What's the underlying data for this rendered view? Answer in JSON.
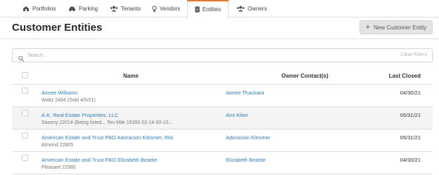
{
  "nav": {
    "tabs": [
      {
        "label": "Portfolios",
        "icon": "building-icon",
        "active": false
      },
      {
        "label": "Parking",
        "icon": "car-icon",
        "active": false
      },
      {
        "label": "Tenants",
        "icon": "users-icon",
        "active": false
      },
      {
        "label": "Vendors",
        "icon": "lightbulb-icon",
        "active": false
      },
      {
        "label": "Entities",
        "icon": "document-icon",
        "active": true
      },
      {
        "label": "Owners",
        "icon": "users-icon",
        "active": false
      }
    ]
  },
  "page": {
    "title": "Customer Entities",
    "new_button_label": "New Customer Entity"
  },
  "search": {
    "placeholder": "Search...",
    "value": "",
    "clear_label": "Clear Filters"
  },
  "table": {
    "columns": [
      "Name",
      "Owner Contact(s)",
      "Last Closed"
    ],
    "rows": [
      {
        "name": "Aimee Williams",
        "detail": "Waltz 2484 (Sold 4/5/21)",
        "owner": "Aimee Thackara",
        "last_closed": "04/30/21"
      },
      {
        "name": "A.K. Real Estate Properties, LLC",
        "detail": "Saxony 22014 (Being listed...   Ten Mile 15350 02-14-30-10...",
        "owner": "Ami Klien",
        "last_closed": "05/31/21"
      },
      {
        "name": "American Estate and Trust FBO Adoracion Klesmer, IRA",
        "detail": "Almond 22805",
        "owner": "Adoracion Klesmer",
        "last_closed": "05/31/21"
      },
      {
        "name": "American Estate and Trust FBO Elizabeth Beattie",
        "detail": "Pleasant 22980",
        "owner": "Elizabeth Beattie",
        "last_closed": "04/30/21"
      }
    ]
  },
  "colors": {
    "accent": "#e8772e",
    "link": "#2f7fc4",
    "row_alt": "#f4f4f4"
  }
}
